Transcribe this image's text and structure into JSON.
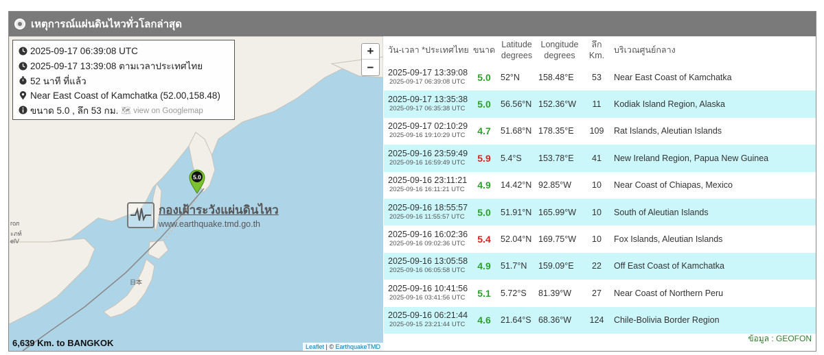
{
  "title": "เหตุการณ์แผ่นดินไหวทั่วโลกล่าสุด",
  "info": {
    "utc_time": "2025-09-17 06:39:08 UTC",
    "thai_time": "2025-09-17 13:39:08 ตามเวลาประเทศไทย",
    "elapsed": "52 นาที ที่แล้ว",
    "location": "Near East Coast of Kamchatka (52.00,158.48)",
    "magnitude_depth": "ขนาด 5.0 , ลึก 53 กม.",
    "googlemap_link": "view on Googlemap"
  },
  "map": {
    "zoom_in": "+",
    "zoom_out": "−",
    "marker_label": "5.0",
    "watermark_title": "กองเฝ้าระวังแผ่นดินไหว",
    "watermark_url": "www.earthquake.tmd.go.th",
    "distance": "6,639 Km. to BANGKOK",
    "attribution_leaflet": "Leaflet",
    "attribution_sep": " | © ",
    "attribution_source": "EarthquakeTMD",
    "label_japan": "日本",
    "label_edge1": "гол",
    "label_edge2": "ะภท์",
    "label_edge3": "elV"
  },
  "table": {
    "headers": {
      "datetime": "วัน-เวลา *ประเทศไทย",
      "magnitude": "ขนาด",
      "latitude": "Latitude",
      "latitude_unit": "degrees",
      "longitude": "Longitude",
      "longitude_unit": "degrees",
      "depth": "ลึก",
      "depth_unit": "Km.",
      "region": "บริเวณศูนย์กลาง"
    },
    "rows": [
      {
        "local": "2025-09-17 13:39:08",
        "utc": "2025-09-17 06:39:08 UTC",
        "mag": "5.0",
        "mag_color": "green",
        "lat": "52°N",
        "lon": "158.48°E",
        "depth": "53",
        "region": "Near East Coast of Kamchatka"
      },
      {
        "local": "2025-09-17 13:35:38",
        "utc": "2025-09-17 06:35:38 UTC",
        "mag": "5.0",
        "mag_color": "green",
        "lat": "56.56°N",
        "lon": "152.36°W",
        "depth": "11",
        "region": "Kodiak Island Region, Alaska"
      },
      {
        "local": "2025-09-17 02:10:29",
        "utc": "2025-09-16 19:10:29 UTC",
        "mag": "4.7",
        "mag_color": "green",
        "lat": "51.68°N",
        "lon": "178.35°E",
        "depth": "109",
        "region": "Rat Islands, Aleutian Islands"
      },
      {
        "local": "2025-09-16 23:59:49",
        "utc": "2025-09-16 16:59:49 UTC",
        "mag": "5.9",
        "mag_color": "red",
        "lat": "5.4°S",
        "lon": "153.78°E",
        "depth": "41",
        "region": "New Ireland Region, Papua New Guinea"
      },
      {
        "local": "2025-09-16 23:11:21",
        "utc": "2025-09-16 16:11:21 UTC",
        "mag": "4.9",
        "mag_color": "green",
        "lat": "14.42°N",
        "lon": "92.85°W",
        "depth": "10",
        "region": "Near Coast of Chiapas, Mexico"
      },
      {
        "local": "2025-09-16 18:55:57",
        "utc": "2025-09-16 11:55:57 UTC",
        "mag": "5.0",
        "mag_color": "green",
        "lat": "51.91°N",
        "lon": "165.99°W",
        "depth": "10",
        "region": "South of Aleutian Islands"
      },
      {
        "local": "2025-09-16 16:02:36",
        "utc": "2025-09-16 09:02:36 UTC",
        "mag": "5.4",
        "mag_color": "red",
        "lat": "52.04°N",
        "lon": "169.75°W",
        "depth": "10",
        "region": "Fox Islands, Aleutian Islands"
      },
      {
        "local": "2025-09-16 13:05:58",
        "utc": "2025-09-16 06:05:58 UTC",
        "mag": "4.9",
        "mag_color": "green",
        "lat": "51.7°N",
        "lon": "159.09°E",
        "depth": "22",
        "region": "Off East Coast of Kamchatka"
      },
      {
        "local": "2025-09-16 10:41:56",
        "utc": "2025-09-16 03:41:56 UTC",
        "mag": "5.1",
        "mag_color": "green",
        "lat": "5.72°S",
        "lon": "81.39°W",
        "depth": "27",
        "region": "Near Coast of Northern Peru"
      },
      {
        "local": "2025-09-16 06:21:44",
        "utc": "2025-09-15 23:21:44 UTC",
        "mag": "4.6",
        "mag_color": "green",
        "lat": "21.64°S",
        "lon": "68.36°W",
        "depth": "124",
        "region": "Chile-Bolivia Border Region"
      }
    ],
    "source": "ข้อมูล : GEOFON"
  },
  "colors": {
    "titlebar": "#7a7a7a",
    "row_alt": "#cbf6fa",
    "mag_green": "#2e9e2e",
    "mag_red": "#d42424",
    "sea": "#aed4e8",
    "land": "#f2efe9"
  }
}
